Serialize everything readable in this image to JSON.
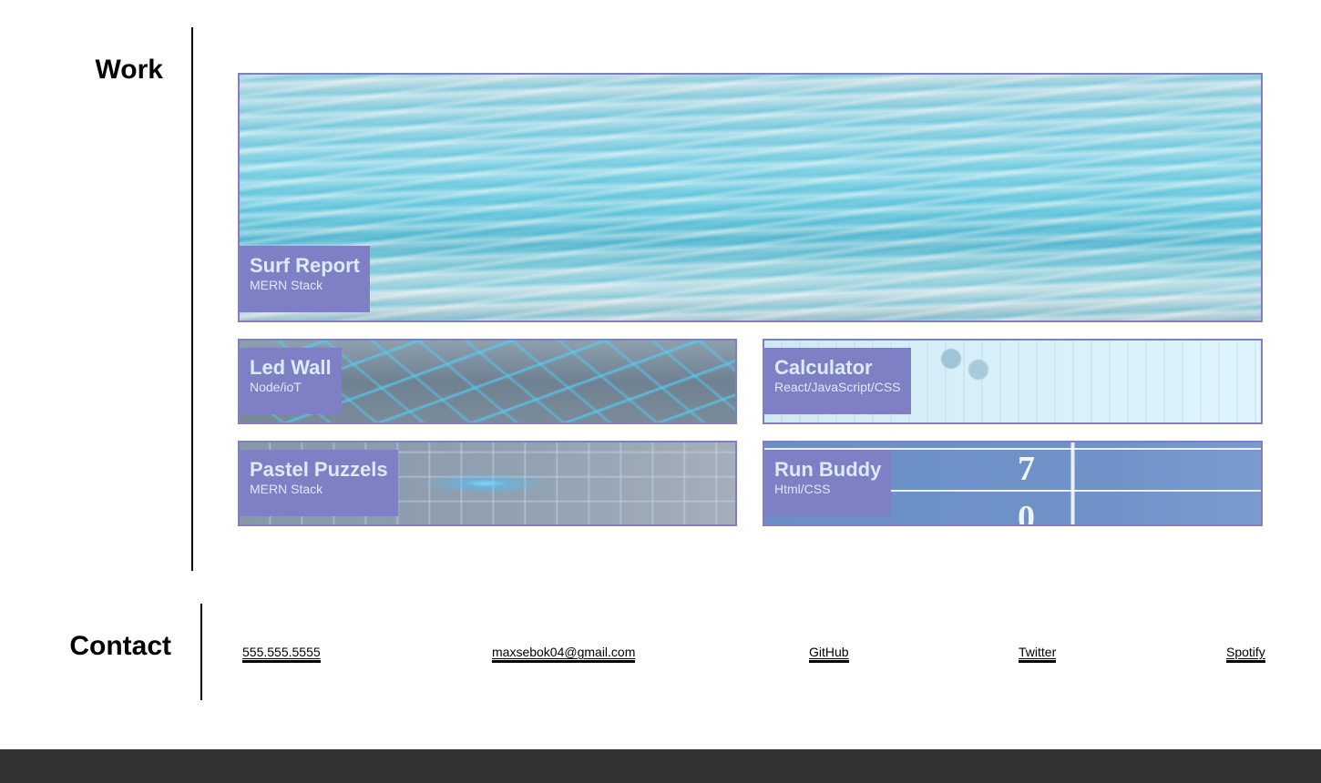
{
  "work": {
    "heading": "Work",
    "projects": [
      {
        "title": "Surf Report",
        "subtitle": "MERN Stack"
      },
      {
        "title": "Led Wall",
        "subtitle": "Node/ioT"
      },
      {
        "title": "Calculator",
        "subtitle": "React/JavaScript/CSS"
      },
      {
        "title": "Pastel Puzzels",
        "subtitle": "MERN Stack"
      },
      {
        "title": "Run Buddy",
        "subtitle": "Html/CSS"
      }
    ]
  },
  "contact": {
    "heading": "Contact",
    "links": [
      {
        "label": "555.555.5555"
      },
      {
        "label": "maxsebok04@gmail.com"
      },
      {
        "label": "GitHub"
      },
      {
        "label": "Twitter"
      },
      {
        "label": "Spotify"
      }
    ]
  },
  "colors": {
    "card_accent": "#7f7fc6",
    "card_text": "#d9ecfc",
    "footer": "#323232"
  }
}
